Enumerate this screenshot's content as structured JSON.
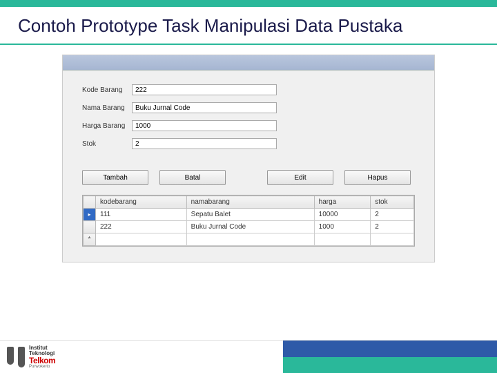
{
  "slide": {
    "title": "Contoh Prototype Task Manipulasi Data Pustaka"
  },
  "form": {
    "labels": {
      "kode": "Kode Barang",
      "nama": "Nama Barang",
      "harga": "Harga Barang",
      "stok": "Stok"
    },
    "values": {
      "kode": "222",
      "nama": "Buku Jurnal Code",
      "harga": "1000",
      "stok": "2"
    }
  },
  "buttons": {
    "tambah": "Tambah",
    "batal": "Batal",
    "edit": "Edit",
    "hapus": "Hapus"
  },
  "grid": {
    "headers": {
      "kode": "kodebarang",
      "nama": "namabarang",
      "harga": "harga",
      "stok": "stok"
    },
    "rows": [
      {
        "kode": "111",
        "nama": "Sepatu Balet",
        "harga": "10000",
        "stok": "2"
      },
      {
        "kode": "222",
        "nama": "Buku Jurnal Code",
        "harga": "1000",
        "stok": "2"
      }
    ]
  },
  "logo": {
    "line1": "Institut",
    "line2": "Teknologi",
    "line3": "Telkom",
    "line4": "Purwokerto"
  }
}
